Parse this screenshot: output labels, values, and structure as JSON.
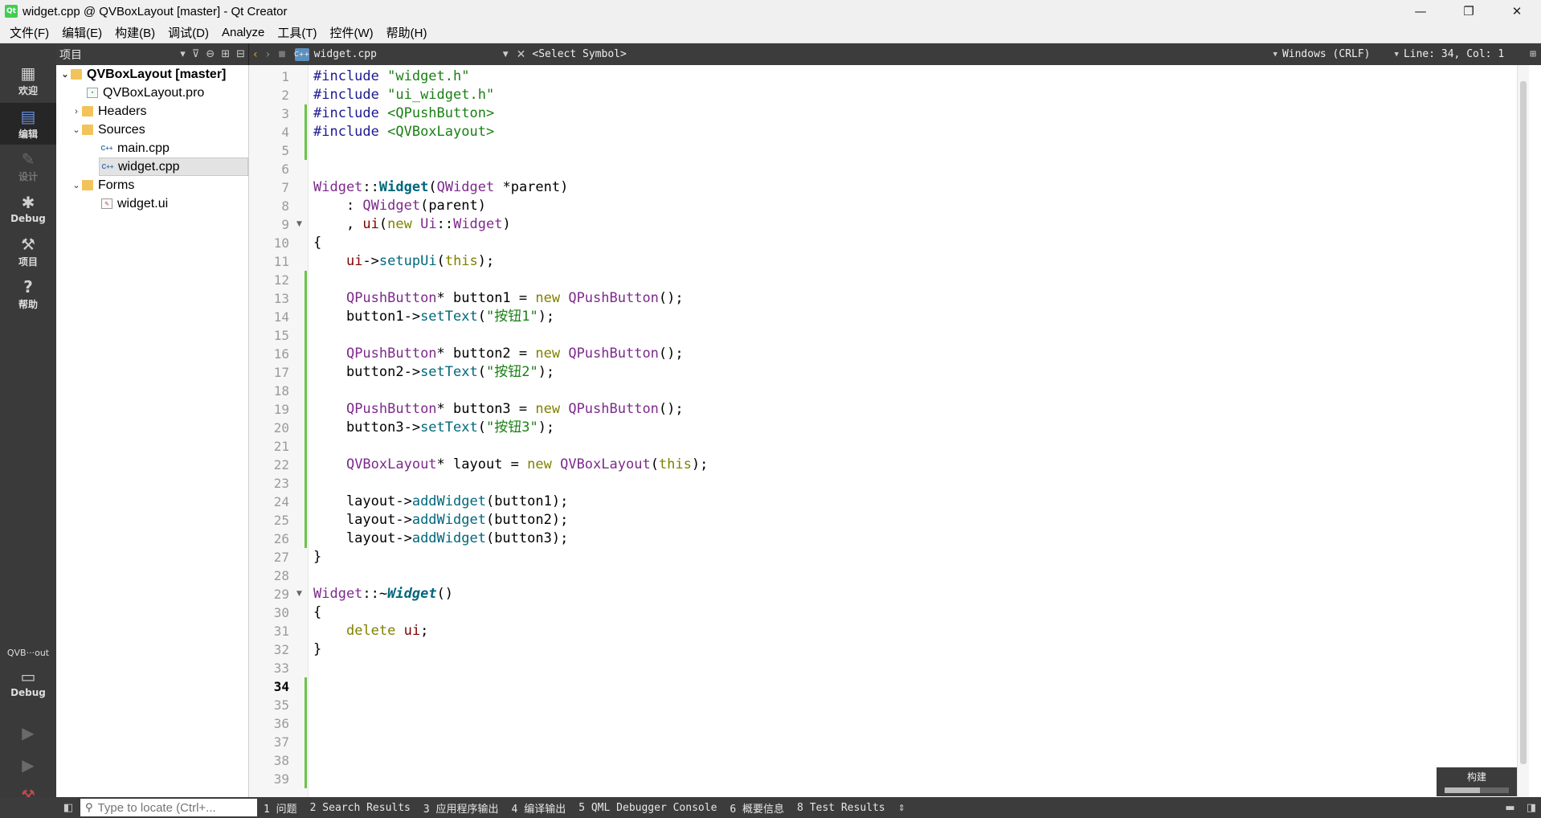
{
  "window": {
    "title": "widget.cpp @ QVBoxLayout [master] - Qt Creator",
    "app_icon": "qt-creator-icon",
    "controls": {
      "minimize": "—",
      "restore": "❐",
      "close": "✕"
    }
  },
  "menubar": {
    "items": [
      "文件(F)",
      "编辑(E)",
      "构建(B)",
      "调试(D)",
      "Analyze",
      "工具(T)",
      "控件(W)",
      "帮助(H)"
    ]
  },
  "modes": [
    {
      "label": "欢迎",
      "icon": "grid-icon"
    },
    {
      "label": "编辑",
      "icon": "edit-icon"
    },
    {
      "label": "设计",
      "icon": "pencil-icon"
    },
    {
      "label": "Debug",
      "icon": "bug-icon"
    },
    {
      "label": "项目",
      "icon": "wrench-icon"
    },
    {
      "label": "帮助",
      "icon": "help-icon"
    }
  ],
  "kit": {
    "label": "QVB···out",
    "mode": "Debug"
  },
  "project_pane": {
    "header": "项目",
    "tree": [
      {
        "label": "QVBoxLayout [master]",
        "level": 0,
        "type": "project",
        "expanded": true
      },
      {
        "label": "QVBoxLayout.pro",
        "level": 1,
        "type": "pro"
      },
      {
        "label": "Headers",
        "level": 1,
        "type": "folder",
        "expanded": false
      },
      {
        "label": "Sources",
        "level": 1,
        "type": "folder",
        "expanded": true
      },
      {
        "label": "main.cpp",
        "level": 2,
        "type": "cpp"
      },
      {
        "label": "widget.cpp",
        "level": 2,
        "type": "cpp",
        "selected": true
      },
      {
        "label": "Forms",
        "level": 1,
        "type": "folder",
        "expanded": true
      },
      {
        "label": "widget.ui",
        "level": 2,
        "type": "ui"
      }
    ]
  },
  "editor_toolbar": {
    "file": "widget.cpp",
    "symbol": "<Select Symbol>",
    "line_ending": "Windows (CRLF)",
    "position": "Line: 34, Col: 1"
  },
  "editor": {
    "current_line": 34,
    "total_lines": 39,
    "lines": [
      [
        [
          "pp",
          "#include "
        ],
        [
          "str",
          "\"widget.h\""
        ]
      ],
      [
        [
          "pp",
          "#include "
        ],
        [
          "str",
          "\"ui_widget.h\""
        ]
      ],
      [
        [
          "pp",
          "#include "
        ],
        [
          "str",
          "<QPushButton>"
        ]
      ],
      [
        [
          "pp",
          "#include "
        ],
        [
          "str",
          "<QVBoxLayout>"
        ]
      ],
      [],
      [],
      [
        [
          "type",
          "Widget"
        ],
        [
          "plain",
          "::"
        ],
        [
          "fndef",
          "Widget"
        ],
        [
          "plain",
          "("
        ],
        [
          "type",
          "QWidget"
        ],
        [
          "plain",
          " *parent)"
        ]
      ],
      [
        [
          "plain",
          "    : "
        ],
        [
          "type",
          "QWidget"
        ],
        [
          "plain",
          "(parent)"
        ]
      ],
      [
        [
          "plain",
          "    , "
        ],
        [
          "field",
          "ui"
        ],
        [
          "plain",
          "("
        ],
        [
          "kw",
          "new "
        ],
        [
          "type",
          "Ui"
        ],
        [
          "plain",
          "::"
        ],
        [
          "type",
          "Widget"
        ],
        [
          "plain",
          ")"
        ]
      ],
      [
        [
          "plain",
          "{"
        ]
      ],
      [
        [
          "plain",
          "    "
        ],
        [
          "field",
          "ui"
        ],
        [
          "plain",
          "->"
        ],
        [
          "fn",
          "setupUi"
        ],
        [
          "plain",
          "("
        ],
        [
          "kw",
          "this"
        ],
        [
          "plain",
          ");"
        ]
      ],
      [],
      [
        [
          "plain",
          "    "
        ],
        [
          "type",
          "QPushButton"
        ],
        [
          "plain",
          "* button1 = "
        ],
        [
          "kw",
          "new "
        ],
        [
          "type",
          "QPushButton"
        ],
        [
          "plain",
          "();"
        ]
      ],
      [
        [
          "plain",
          "    button1->"
        ],
        [
          "fn",
          "setText"
        ],
        [
          "plain",
          "("
        ],
        [
          "str",
          "\"按钮1\""
        ],
        [
          "plain",
          ");"
        ]
      ],
      [],
      [
        [
          "plain",
          "    "
        ],
        [
          "type",
          "QPushButton"
        ],
        [
          "plain",
          "* button2 = "
        ],
        [
          "kw",
          "new "
        ],
        [
          "type",
          "QPushButton"
        ],
        [
          "plain",
          "();"
        ]
      ],
      [
        [
          "plain",
          "    button2->"
        ],
        [
          "fn",
          "setText"
        ],
        [
          "plain",
          "("
        ],
        [
          "str",
          "\"按钮2\""
        ],
        [
          "plain",
          ");"
        ]
      ],
      [],
      [
        [
          "plain",
          "    "
        ],
        [
          "type",
          "QPushButton"
        ],
        [
          "plain",
          "* button3 = "
        ],
        [
          "kw",
          "new "
        ],
        [
          "type",
          "QPushButton"
        ],
        [
          "plain",
          "();"
        ]
      ],
      [
        [
          "plain",
          "    button3->"
        ],
        [
          "fn",
          "setText"
        ],
        [
          "plain",
          "("
        ],
        [
          "str",
          "\"按钮3\""
        ],
        [
          "plain",
          ");"
        ]
      ],
      [],
      [
        [
          "plain",
          "    "
        ],
        [
          "type",
          "QVBoxLayout"
        ],
        [
          "plain",
          "* layout = "
        ],
        [
          "kw",
          "new "
        ],
        [
          "type",
          "QVBoxLayout"
        ],
        [
          "plain",
          "("
        ],
        [
          "kw",
          "this"
        ],
        [
          "plain",
          ");"
        ]
      ],
      [],
      [
        [
          "plain",
          "    layout->"
        ],
        [
          "fn",
          "addWidget"
        ],
        [
          "plain",
          "(button1);"
        ]
      ],
      [
        [
          "plain",
          "    layout->"
        ],
        [
          "fn",
          "addWidget"
        ],
        [
          "plain",
          "(button2);"
        ]
      ],
      [
        [
          "plain",
          "    layout->"
        ],
        [
          "fn",
          "addWidget"
        ],
        [
          "plain",
          "(button3);"
        ]
      ],
      [
        [
          "plain",
          "}"
        ]
      ],
      [],
      [
        [
          "type",
          "Widget"
        ],
        [
          "plain",
          "::~"
        ],
        [
          "fnital",
          "Widget"
        ],
        [
          "plain",
          "()"
        ]
      ],
      [
        [
          "plain",
          "{"
        ]
      ],
      [
        [
          "plain",
          "    "
        ],
        [
          "kw",
          "delete "
        ],
        [
          "field",
          "ui"
        ],
        [
          "plain",
          ";"
        ]
      ],
      [
        [
          "plain",
          "}"
        ]
      ],
      [],
      [],
      [],
      [],
      [],
      [],
      []
    ],
    "folds": [
      9,
      29
    ]
  },
  "build_indicator": {
    "label": "构建",
    "progress": 0.55
  },
  "statusbar": {
    "locator_placeholder": "Type to locate (Ctrl+...",
    "tabs": [
      "1 问题",
      "2 Search Results",
      "3 应用程序输出",
      "4 编译输出",
      "5 QML Debugger Console",
      "6 概要信息",
      "8 Test Results"
    ]
  }
}
